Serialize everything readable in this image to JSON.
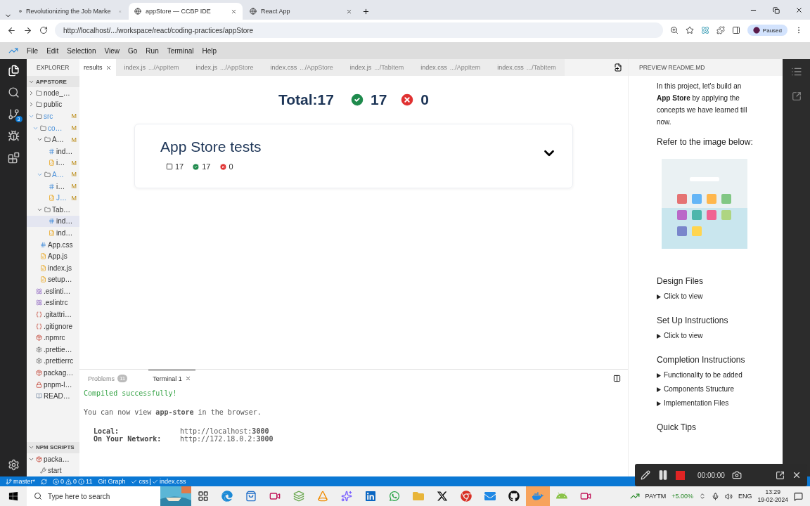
{
  "browser": {
    "tabs": [
      {
        "title": "Revolutionizing the Job Marke",
        "selected": false
      },
      {
        "title": "appStore — CCBP IDE",
        "selected": true
      },
      {
        "title": "React App",
        "selected": false
      }
    ],
    "address": "http://localhost/.../workspace/react/coding-practices/appStore",
    "profile": "Paused"
  },
  "menu": [
    "File",
    "Edit",
    "Selection",
    "View",
    "Go",
    "Run",
    "Terminal",
    "Help"
  ],
  "activity": {
    "badge": "3"
  },
  "explorer": {
    "title": "EXPLORER",
    "section": "APPSTORE",
    "tree": [
      {
        "label": "node_…",
        "kind": "folder",
        "expanded": false,
        "highlighted": false,
        "selected": false
      },
      {
        "label": "public",
        "kind": "folder",
        "expanded": false,
        "highlighted": false,
        "selected": false
      },
      {
        "label": "src",
        "kind": "folder",
        "expanded": true,
        "status": "M",
        "highlighted": true,
        "selected": false,
        "children": [
          {
            "label": "co…",
            "kind": "folder",
            "expanded": true,
            "status": "M",
            "highlighted": true,
            "selected": false,
            "children": [
              {
                "label": "A…",
                "kind": "folder",
                "expanded": true,
                "status": "M",
                "highlighted": false,
                "selected": false,
                "children": [
                  {
                    "label": "ind…",
                    "kind": "css",
                    "highlighted": false,
                    "selected": false
                  },
                  {
                    "label": "i…",
                    "kind": "js",
                    "status": "M",
                    "highlighted": false,
                    "selected": false
                  }
                ]
              },
              {
                "label": "A…",
                "kind": "folder",
                "expanded": true,
                "status": "M",
                "highlighted": true,
                "selected": false,
                "children": [
                  {
                    "label": "i…",
                    "kind": "css",
                    "status": "M",
                    "highlighted": false,
                    "selected": false
                  },
                  {
                    "label": "J…",
                    "kind": "js",
                    "status": "M",
                    "highlighted": true,
                    "selected": false
                  }
                ]
              },
              {
                "label": "Tab…",
                "kind": "folder",
                "expanded": true,
                "highlighted": false,
                "selected": false,
                "children": [
                  {
                    "label": "ind…",
                    "kind": "css",
                    "highlighted": false,
                    "selected": true
                  },
                  {
                    "label": "ind…",
                    "kind": "js",
                    "highlighted": false,
                    "selected": false
                  }
                ]
              }
            ]
          },
          {
            "label": "App.css",
            "kind": "css",
            "highlighted": false,
            "selected": false
          },
          {
            "label": "App.js",
            "kind": "js",
            "highlighted": false,
            "selected": false
          },
          {
            "label": "index.js",
            "kind": "js",
            "highlighted": false,
            "selected": false
          },
          {
            "label": "setup…",
            "kind": "js",
            "highlighted": false,
            "selected": false
          }
        ]
      },
      {
        "label": ".eslinti…",
        "kind": "eslint",
        "highlighted": false,
        "selected": false
      },
      {
        "label": ".eslintrc",
        "kind": "eslint",
        "highlighted": false,
        "selected": false
      },
      {
        "label": ".gitattri…",
        "kind": "git",
        "highlighted": false,
        "selected": false
      },
      {
        "label": ".gitignore",
        "kind": "git",
        "highlighted": false,
        "selected": false
      },
      {
        "label": ".npmrc",
        "kind": "npm",
        "highlighted": false,
        "selected": false
      },
      {
        "label": ".prettie…",
        "kind": "prettier",
        "highlighted": false,
        "selected": false
      },
      {
        "label": ".prettierrc",
        "kind": "prettier",
        "highlighted": false,
        "selected": false
      },
      {
        "label": "packag…",
        "kind": "npm",
        "highlighted": false,
        "selected": false
      },
      {
        "label": "pnpm-l…",
        "kind": "lock",
        "highlighted": false,
        "selected": false
      },
      {
        "label": "READ…",
        "kind": "readme",
        "highlighted": false,
        "selected": false
      }
    ],
    "npm_section": "NPM SCRIPTS",
    "npm_tree": [
      {
        "label": "packa…",
        "kind": "npm",
        "expanded": true,
        "highlighted": false,
        "selected": false,
        "children": [
          {
            "label": "start",
            "kind": "script",
            "highlighted": false,
            "selected": false
          }
        ]
      }
    ]
  },
  "editor_tabs": [
    {
      "label": "results",
      "selected": true
    },
    {
      "label": "index.js",
      "path": ".../AppItem",
      "selected": false
    },
    {
      "label": "index.js",
      "path": ".../AppStore",
      "selected": false
    },
    {
      "label": "index.css",
      "path": ".../AppStore",
      "selected": false
    },
    {
      "label": "index.js",
      "path": ".../TabItem",
      "selected": false
    },
    {
      "label": "index.css",
      "path": ".../AppItem",
      "selected": false
    },
    {
      "label": "index.css",
      "path": ".../TabItem",
      "selected": false
    }
  ],
  "results": {
    "total": "Total:17",
    "passed": "17",
    "failed": "0",
    "suite": {
      "title": "App Store tests",
      "count": "17",
      "passed": "17",
      "failed": "0",
      "expanded": false
    }
  },
  "panel": {
    "tabs": [
      {
        "label": "Problems",
        "badge": "11",
        "selected": false
      },
      {
        "label": "Terminal 1",
        "selected": true
      }
    ],
    "success": "Compiled successfully!",
    "message": "You can now view **app-store** in the browser.",
    "urls": [
      {
        "label": "Local:",
        "value": "http://localhost:**3000**"
      },
      {
        "label": "On Your Network:",
        "value": "http://172.18.0.2:**3000**"
      }
    ]
  },
  "readme": {
    "title": "PREVIEW README.MD",
    "intro": "In this project, let's build an **App Store** by applying the concepts we have learned till now.",
    "refer": "Refer to the image below:",
    "sections": [
      {
        "title": "Design Files",
        "items": [
          "Click to view"
        ]
      },
      {
        "title": "Set Up Instructions",
        "items": [
          "Click to view"
        ]
      },
      {
        "title": "Completion Instructions",
        "items": [
          "Functionality to be added",
          "Components Structure",
          "Implementation Files"
        ]
      },
      {
        "title": "Quick Tips"
      }
    ]
  },
  "status_bar": {
    "branch": "master*",
    "errors": "0",
    "warnings": "0",
    "info": "11",
    "git_graph": "Git Graph",
    "language": "css",
    "file": "index.css"
  },
  "recorder": {
    "time": "00:00:00"
  },
  "taskbar": {
    "search": {
      "placeholder": "Type here to search"
    },
    "apps": [
      {
        "kind": "taskview",
        "selected": false
      },
      {
        "kind": "edge",
        "selected": false
      },
      {
        "kind": "store",
        "selected": false
      },
      {
        "kind": "recorder",
        "selected": false
      },
      {
        "kind": "layers",
        "selected": false
      },
      {
        "kind": "vlc",
        "selected": false
      },
      {
        "kind": "copilot",
        "selected": false
      },
      {
        "kind": "linkedin",
        "selected": false
      },
      {
        "kind": "whatsapp",
        "selected": false
      },
      {
        "kind": "files",
        "selected": false
      },
      {
        "kind": "x",
        "selected": false
      },
      {
        "kind": "chrome",
        "selected": false
      },
      {
        "kind": "mail",
        "selected": false
      },
      {
        "kind": "github",
        "selected": false
      },
      {
        "kind": "docker",
        "selected": true
      },
      {
        "kind": "android",
        "selected": false
      },
      {
        "kind": "recorder",
        "selected": false
      }
    ],
    "stock": {
      "name": "PAYTM",
      "change": "+5.00%"
    },
    "language": "ENG",
    "time": "13:29",
    "date": "19-02-2024"
  }
}
